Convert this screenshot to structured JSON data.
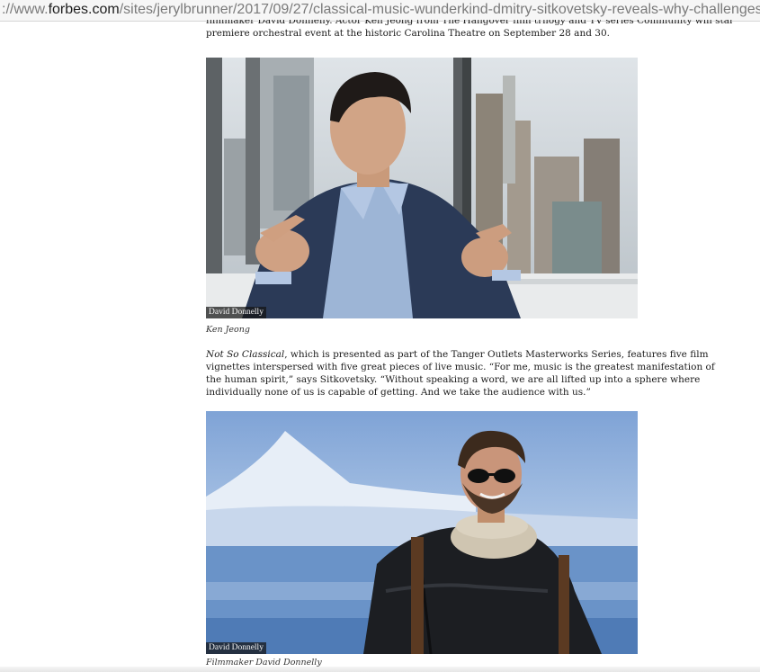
{
  "browser": {
    "url_prefix": "://www.",
    "url_host": "forbes.com",
    "url_path": "/sites/jerylbrunner/2017/09/27/classical-music-wunderkind-dmitry-sitkovetsky-reveals-why-challenges-help-us"
  },
  "article": {
    "intro_cut_line": "filmmaker David Donnelly. Actor Ken Jeong from The Hangover film trilogy and TV series Community will star in this world-",
    "intro_line_2": "premiere orchestral event at the historic Carolina Theatre on September 28 and 30.",
    "figure_1": {
      "credit": "David Donnelly",
      "caption": "Ken Jeong"
    },
    "body_italic": "Not So Classical",
    "body_text": ", which is presented as part of the Tanger Outlets Masterworks Series, features five film vignettes interspersed with five great pieces of live music. “For me, music is the greatest manifestation of the human spirit,” says Sitkovetsky. “Without speaking a word, we are all lifted up into a sphere where individually none of us is capable of getting. And we take the audience with us.”",
    "figure_2": {
      "credit": "David Donnelly",
      "caption": "Filmmaker David Donnelly"
    }
  }
}
